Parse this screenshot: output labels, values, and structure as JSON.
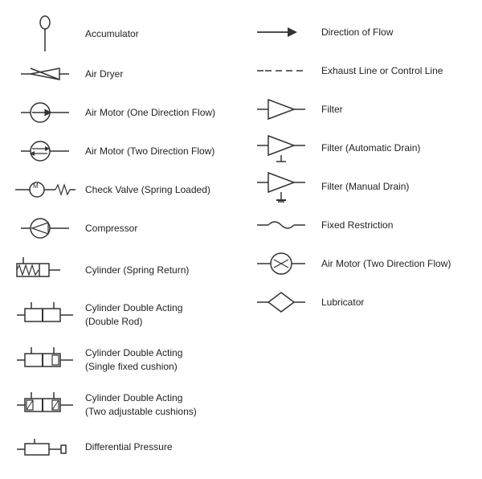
{
  "left_items": [
    {
      "id": "accumulator",
      "label": "Accumulator"
    },
    {
      "id": "air-dryer",
      "label": "Air Dryer"
    },
    {
      "id": "air-motor-one",
      "label": "Air Motor (One Direction Flow)"
    },
    {
      "id": "air-motor-two",
      "label": "Air Motor (Two Direction Flow)"
    },
    {
      "id": "check-valve",
      "label": "Check Valve (Spring Loaded)"
    },
    {
      "id": "compressor",
      "label": "Compressor"
    },
    {
      "id": "cylinder-spring",
      "label": "Cylinder (Spring Return)"
    },
    {
      "id": "cylinder-double-double",
      "label": "Cylinder Double Acting\n(Double Rod)"
    },
    {
      "id": "cylinder-double-single",
      "label": "Cylinder Double Acting\n(Single fixed cushion)"
    },
    {
      "id": "cylinder-double-two",
      "label": "Cylinder Double Acting\n(Two adjustable cushions)"
    },
    {
      "id": "differential",
      "label": "Differential Pressure"
    }
  ],
  "right_items": [
    {
      "id": "direction-flow",
      "label": "Direction of Flow"
    },
    {
      "id": "exhaust-line",
      "label": "Exhaust Line or Control Line"
    },
    {
      "id": "filter",
      "label": "Filter"
    },
    {
      "id": "filter-auto",
      "label": "Filter (Automatic Drain)"
    },
    {
      "id": "filter-manual",
      "label": "Filter (Manual Drain)"
    },
    {
      "id": "fixed-restriction",
      "label": "Fixed Restriction"
    },
    {
      "id": "air-motor-two-right",
      "label": "Air Motor (Two Direction Flow)"
    },
    {
      "id": "lubricator",
      "label": "Lubricator"
    }
  ]
}
